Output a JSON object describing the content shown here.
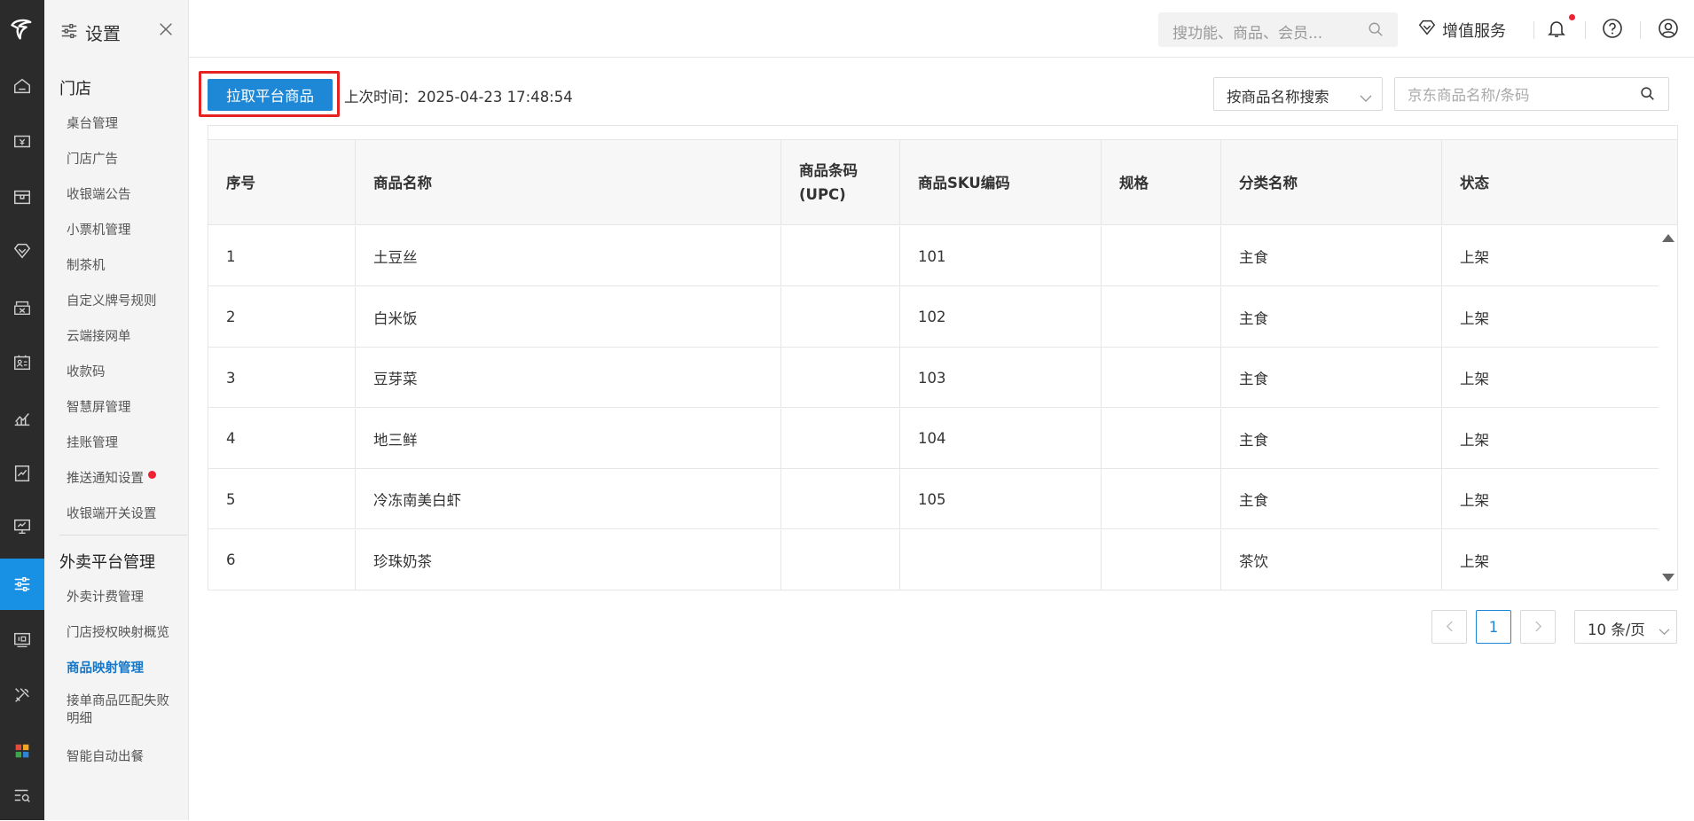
{
  "sidebar": {
    "title": "设置",
    "groups": [
      {
        "label": "门店",
        "items": [
          "桌台管理",
          "门店广告",
          "收银端公告",
          "小票机管理",
          "制茶机",
          "自定义牌号规则",
          "云端接网单",
          "收款码",
          "智慧屏管理",
          "挂账管理",
          "推送通知设置",
          "收银端开关设置"
        ]
      },
      {
        "label": "外卖平台管理",
        "items": [
          "外卖计费管理",
          "门店授权映射概览",
          "商品映射管理",
          "接单商品匹配失败明细",
          "智能自动出餐"
        ]
      }
    ],
    "selected": "商品映射管理"
  },
  "topbar": {
    "search_placeholder": "搜功能、商品、会员...",
    "value_service": "增值服务"
  },
  "toolbar": {
    "pull_button": "拉取平台商品",
    "last_time": "上次时间：2025-04-23 17:48:54",
    "search_mode": "按商品名称搜索",
    "keyword_placeholder": "京东商品名称/条码"
  },
  "table": {
    "headers": [
      "序号",
      "商品名称",
      "商品条码(UPC)",
      "商品SKU编码",
      "规格",
      "分类名称",
      "状态"
    ],
    "header_upc_line1": "商品条码",
    "header_upc_line2": "(UPC)",
    "rows": [
      [
        "1",
        "土豆丝",
        "",
        "101",
        "",
        "主食",
        "上架"
      ],
      [
        "2",
        "白米饭",
        "",
        "102",
        "",
        "主食",
        "上架"
      ],
      [
        "3",
        "豆芽菜",
        "",
        "103",
        "",
        "主食",
        "上架"
      ],
      [
        "4",
        "地三鲜",
        "",
        "104",
        "",
        "主食",
        "上架"
      ],
      [
        "5",
        "冷冻南美白虾",
        "",
        "105",
        "",
        "主食",
        "上架"
      ],
      [
        "6",
        "珍珠奶茶",
        "",
        "",
        "",
        "茶饮",
        "上架"
      ]
    ]
  },
  "pagination": {
    "current_page": "1",
    "page_size": "10 条/页"
  },
  "colors": {
    "accent": "#1e88d6",
    "highlight_border": "#e62323",
    "rail_bg": "#2b2b2b",
    "notification_dot": "#ee2233"
  },
  "icons": [
    "logo-icon",
    "home-icon",
    "cashier-icon",
    "box-icon",
    "diamond-icon",
    "coupon-icon",
    "member-card-icon",
    "chart-icon",
    "report-icon",
    "monitor-icon",
    "settings-sliders-icon",
    "device-icon",
    "tools-icon",
    "apps-icon",
    "menu-search-icon",
    "close-icon",
    "search-icon",
    "bell-icon",
    "help-icon",
    "user-icon",
    "chevron-down-icon",
    "chevron-left-icon",
    "chevron-right-icon"
  ]
}
